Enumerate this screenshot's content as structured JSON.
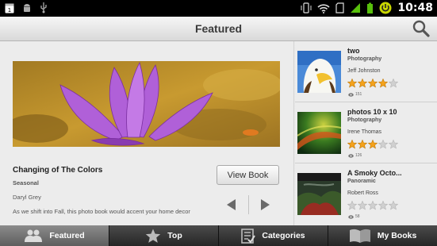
{
  "status_bar": {
    "time": "10:48"
  },
  "header": {
    "title": "Featured"
  },
  "featured": {
    "title": "Changing of The Colors",
    "category": "Seasonal",
    "author": "Daryl Grey",
    "description": "As we shift into Fall, this photo book would  accent your home decor",
    "view_button": "View Book"
  },
  "side_list": [
    {
      "title": "two",
      "category": "Photography",
      "author": "Jeff Johnston",
      "rating": 4,
      "views": "151"
    },
    {
      "title": "photos 10 x 10",
      "category": "Photography",
      "author": "Irene Thomas",
      "rating": 3,
      "views": "126"
    },
    {
      "title": "A Smoky Octo...",
      "category": "Panoramic",
      "author": "Robert Ross",
      "rating": 0,
      "views": "58"
    }
  ],
  "tabs": [
    {
      "label": "Featured",
      "icon": "people-icon"
    },
    {
      "label": "Top",
      "icon": "star-icon"
    },
    {
      "label": "Categories",
      "icon": "checklist-icon"
    },
    {
      "label": "My Books",
      "icon": "book-icon"
    }
  ],
  "colors": {
    "star_on": "#f4a21c",
    "star_off": "#d0d0d0",
    "accent_green": "#58c00c"
  }
}
